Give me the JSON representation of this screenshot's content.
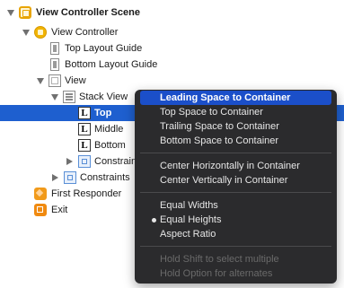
{
  "tree": {
    "scene": "View Controller Scene",
    "view_controller": "View Controller",
    "top_layout_guide": "Top Layout Guide",
    "bottom_layout_guide": "Bottom Layout Guide",
    "view": "View",
    "stack_view": "Stack View",
    "label_top": "Top",
    "label_top_glyph": "L",
    "label_middle": "Middle",
    "label_middle_glyph": "L",
    "label_bottom": "Bottom",
    "label_bottom_glyph": "L",
    "constraints_inner": "Constraints",
    "constraints_outer": "Constraints",
    "first_responder": "First Responder",
    "exit": "Exit"
  },
  "context_menu": {
    "items": [
      "Leading Space to Container",
      "Top Space to Container",
      "Trailing Space to Container",
      "Bottom Space to Container",
      "Center Horizontally in Container",
      "Center Vertically in Container",
      "Equal Widths",
      "Equal Heights",
      "Aspect Ratio"
    ],
    "hints": [
      "Hold Shift to select multiple",
      "Hold Option for alternates"
    ],
    "highlighted_item": "Leading Space to Container",
    "checked_item": "Equal Heights"
  },
  "colors": {
    "selection": "#1e5fcf",
    "menu_background": "#2b2b2d",
    "menu_highlight": "#1b4fc9"
  }
}
